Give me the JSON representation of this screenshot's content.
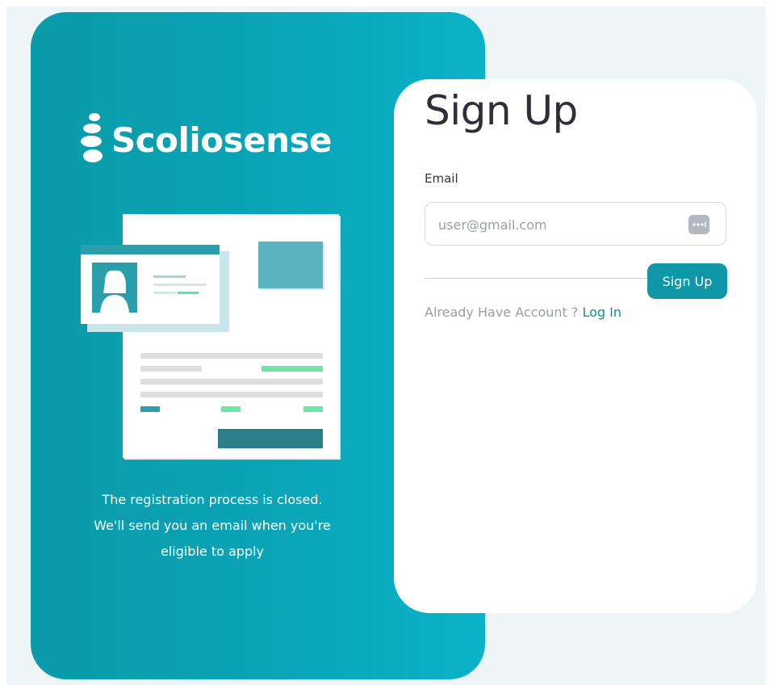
{
  "brand": {
    "name": "Scoliosense",
    "colors": {
      "primary": "#0aa6b9",
      "accent": "#57e6a0"
    }
  },
  "notice": {
    "line1": "The registration process is closed.",
    "line2": "We'll send you an email when you're",
    "line3": "eligible to apply"
  },
  "form": {
    "title": "Sign Up",
    "email_label": "Email",
    "email_placeholder": "user@gmail.com",
    "email_value": "",
    "submit_label": "Sign Up",
    "account_prompt": "Already Have Account ? ",
    "login_label": "Log In",
    "field_icon": "dots-icon"
  }
}
